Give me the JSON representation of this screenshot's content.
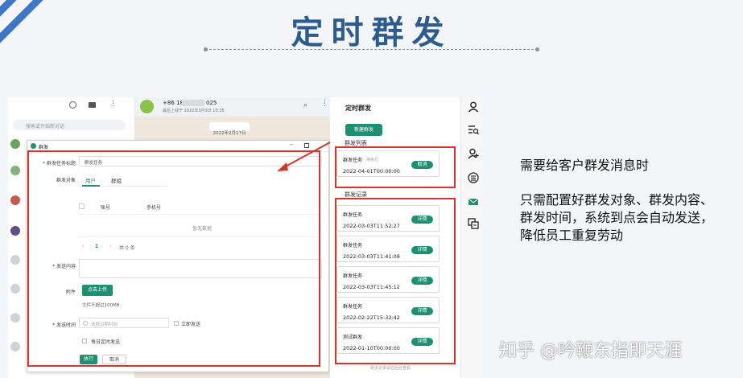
{
  "slide": {
    "title": "定时群发",
    "description_line1": "需要给客户群发消息时",
    "description_line2": "只需配置好群发对象、群发内容、",
    "description_line3": "群发时间，系统到点会自动发送，",
    "description_line4": "降低员工重复劳动",
    "watermark": "知乎 @吟鞭东指即天涯",
    "accent_color": "#3d78c7",
    "title_color": "#2c5b8e",
    "highlight_color": "#d9342b"
  },
  "whatsapp": {
    "search_placeholder": "搜索或开始新对话",
    "contact_number_prefix": "+86 18",
    "contact_number_suffix": "025",
    "last_seen": "最后上线于 2022年3月3日 10:35",
    "date_chip": "2022年2月17日"
  },
  "dialog": {
    "title": "群发",
    "task_title_label": "* 群发任务标题",
    "task_title_value": "群发任务",
    "target_label": "群发对象",
    "tabs": [
      "用户",
      "群组"
    ],
    "col_account": "账号",
    "col_phone": "手机号",
    "empty_text": "暂无数据",
    "page_current": "1",
    "page_total": "共 0 条",
    "content_label": "* 发送内容",
    "attachment_label": "附件",
    "upload_button": "点击上传",
    "upload_hint": "文件不超过100MB",
    "time_label": "* 发送时间",
    "time_placeholder": "选择日期时间",
    "send_now": "立即发送",
    "daily_send": "每日定时发送",
    "execute_button": "执行",
    "cancel_button": "取消"
  },
  "panel": {
    "heading": "定时群发",
    "new_button": "新建群发",
    "list_heading": "群发列表",
    "pending": {
      "name": "群发任务",
      "status": "待执行",
      "datetime": "2022-04-01T00:00:00",
      "action": "取消"
    },
    "records_heading": "群发记录",
    "records": [
      {
        "name": "群发任务",
        "datetime": "2022-03-03T11:52:27",
        "action": "详情"
      },
      {
        "name": "群发任务",
        "datetime": "2022-03-03T11:41:08",
        "action": "详情"
      },
      {
        "name": "群发任务",
        "datetime": "2022-03-03T11:45:12",
        "action": "详情"
      },
      {
        "name": "群发任务",
        "datetime": "2022-02-22T15:32:42",
        "action": "详情"
      },
      {
        "name": "测试群发",
        "datetime": "2022-01-10T00:00:00",
        "action": "详情"
      }
    ],
    "footer": "更多记录请在后台查看"
  },
  "icons": [
    "user-icon",
    "search-list-icon",
    "add-user-icon",
    "list-icon",
    "mail-icon",
    "translate-icon"
  ]
}
